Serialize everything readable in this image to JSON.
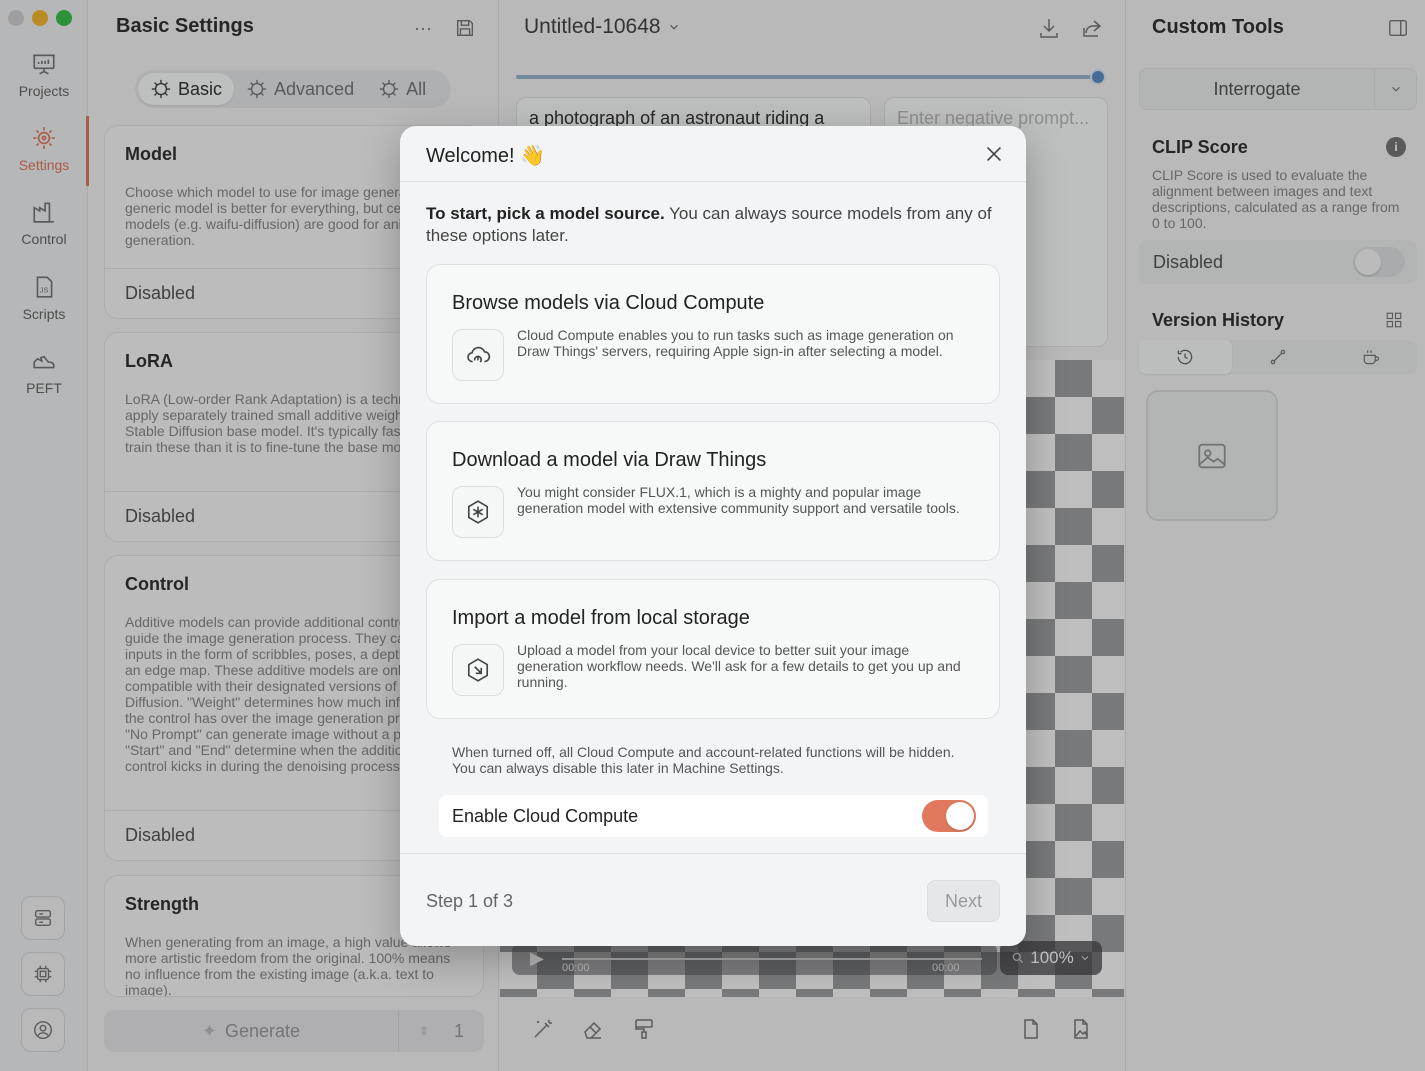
{
  "window": {
    "traffic_colors": [
      "#d0d0d0",
      "#f5b731",
      "#3cc14a"
    ]
  },
  "nav": {
    "items": [
      {
        "label": "Projects",
        "icon": "presentation-icon"
      },
      {
        "label": "Settings",
        "icon": "settings-gear-icon",
        "active": true
      },
      {
        "label": "Control",
        "icon": "factory-icon"
      },
      {
        "label": "Scripts",
        "icon": "js-file-icon"
      },
      {
        "label": "PEFT",
        "icon": "shoe-icon"
      }
    ],
    "bottom_buttons": [
      "server-icon",
      "chip-icon",
      "account-icon"
    ]
  },
  "settings": {
    "title": "Basic Settings",
    "tabs": [
      {
        "label": "Basic",
        "active": true
      },
      {
        "label": "Advanced"
      },
      {
        "label": "All"
      }
    ],
    "cards": [
      {
        "title": "Model",
        "desc": "Choose which model to use for image generation. A generic model is better for everything, but certain models (e.g. waifu-diffusion) are good for anime style generation.",
        "value": "Disabled"
      },
      {
        "title": "LoRA",
        "desc": "LoRA (Low-order Rank Adaptation) is a technique to apply separately trained small additive weights to a Stable Diffusion base model. It's typically faster to train these than it is to fine-tune the base model.",
        "value": "Disabled"
      },
      {
        "title": "Control",
        "desc": "Additive models can provide additional controls to guide the image generation process. They can take inputs in the form of scribbles, poses, a depth map or an edge map. These additive models are only compatible with their designated versions of Stable Diffusion. \"Weight\" determines how much influence the control has over the image generation process. \"No Prompt\" can generate image without a prompt. \"Start\" and \"End\" determine when the additional control kicks in during the denoising process.",
        "value": "Disabled"
      },
      {
        "title": "Strength",
        "desc": "When generating from an image, a high value allows more artistic freedom from the original. 100% means no influence from the existing image (a.k.a. text to image)."
      }
    ],
    "generate_label": "Generate",
    "batch_count": "1"
  },
  "canvas": {
    "doc_title": "Untitled-10648",
    "prompt": "a photograph of an astronaut riding a",
    "negative_placeholder": "Enter negative prompt...",
    "time_start": "00:00",
    "time_end": "00:00",
    "zoom": "100%"
  },
  "tools": {
    "title": "Custom Tools",
    "interrogate": "Interrogate",
    "clip_title": "CLIP Score",
    "clip_desc": "CLIP Score is used to evaluate the alignment between images and text descriptions, calculated as a range from 0 to 100.",
    "clip_value": "Disabled",
    "version_history": "Version History"
  },
  "modal": {
    "title": "Welcome! 👋",
    "intro_bold": "To start, pick a model source.",
    "intro_rest": " You can always source models from any of these options later.",
    "options": [
      {
        "title": "Browse models via Cloud Compute",
        "icon": "cloud-icon",
        "desc": "Cloud Compute enables you to run tasks such as image generation on Draw Things' servers, requiring Apple sign-in after selecting a model."
      },
      {
        "title": "Download a model via Draw Things",
        "icon": "asterisk-hexagon-icon",
        "desc": "You might consider FLUX.1, which is a mighty and popular image generation model with extensive community support and versatile tools."
      },
      {
        "title": "Import a model from local storage",
        "icon": "import-hexagon-icon",
        "desc": "Upload a model from your local device to better suit your image generation workflow needs. We'll ask for a few details to get you up and running."
      }
    ],
    "cloud_note": "When turned off, all Cloud Compute and account-related functions will be hidden. You can always disable this later in Machine Settings.",
    "cloud_toggle_label": "Enable Cloud Compute",
    "cloud_enabled": true,
    "step": "Step 1 of 3",
    "next": "Next",
    "accent": "#e0795d"
  }
}
